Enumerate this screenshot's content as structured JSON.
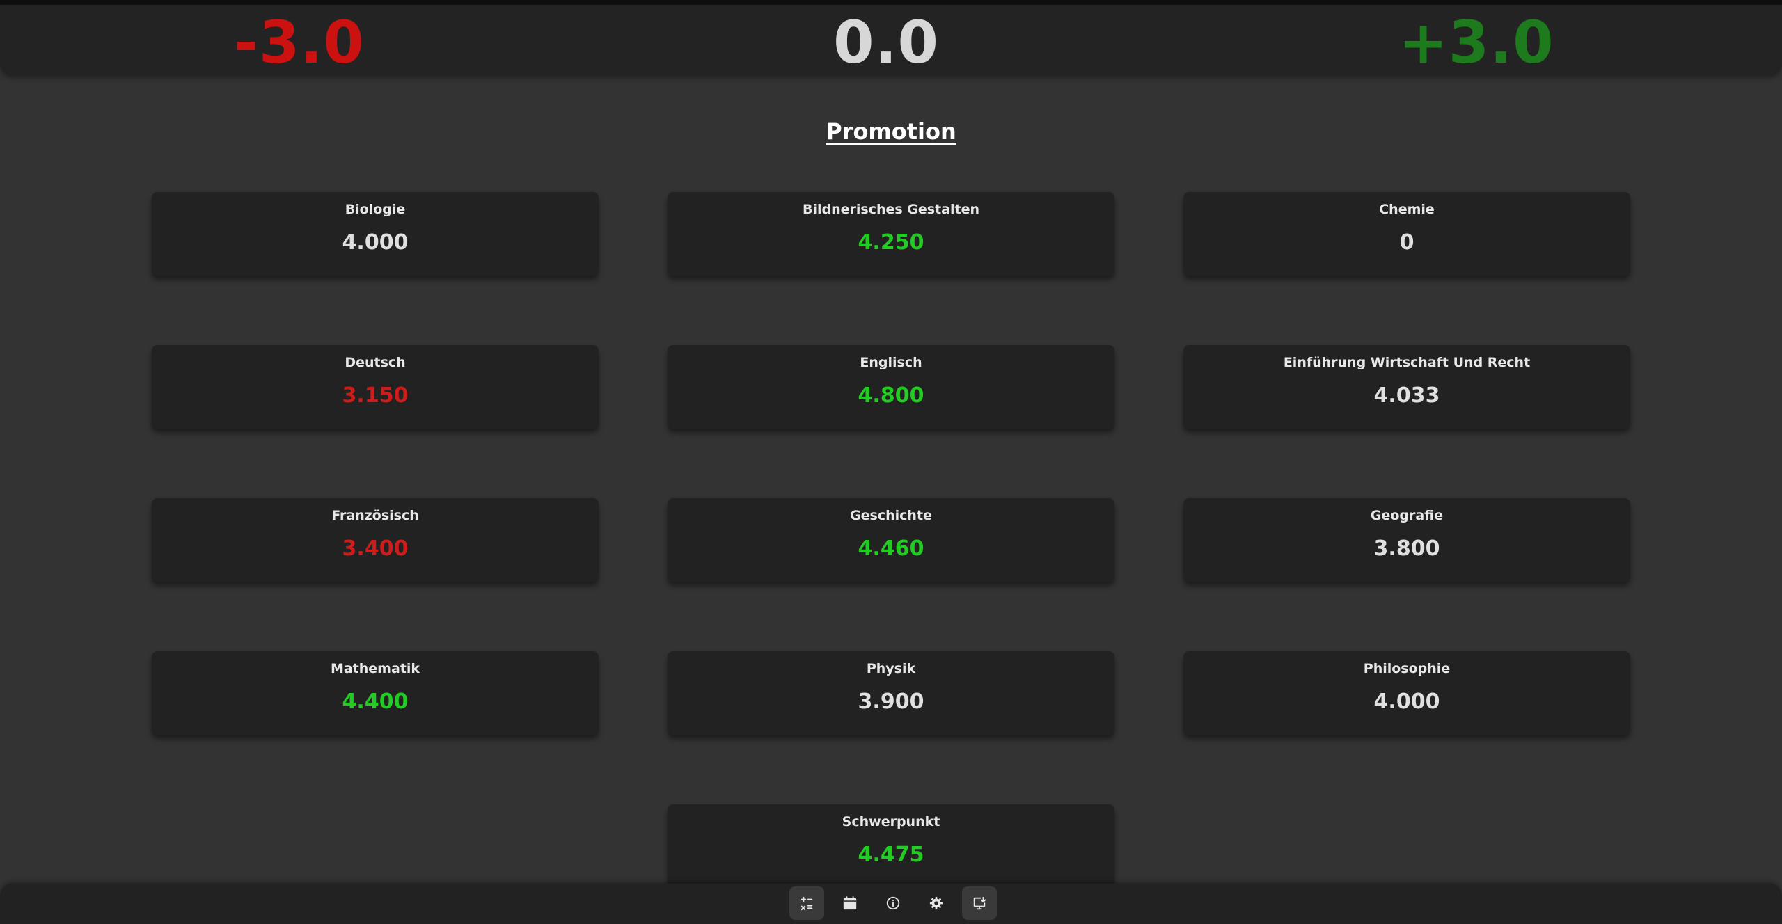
{
  "scores": {
    "negative": "-3.0",
    "zero": "0.0",
    "positive": "+3.0"
  },
  "page_title": "Promotion",
  "subjects": [
    {
      "name": "Biologie",
      "grade": "4.000",
      "status": "neutral"
    },
    {
      "name": "Bildnerisches Gestalten",
      "grade": "4.250",
      "status": "good"
    },
    {
      "name": "Chemie",
      "grade": "0",
      "status": "neutral"
    },
    {
      "name": "Deutsch",
      "grade": "3.150",
      "status": "bad"
    },
    {
      "name": "Englisch",
      "grade": "4.800",
      "status": "good"
    },
    {
      "name": "Einführung Wirtschaft Und Recht",
      "grade": "4.033",
      "status": "neutral"
    },
    {
      "name": "Französisch",
      "grade": "3.400",
      "status": "bad"
    },
    {
      "name": "Geschichte",
      "grade": "4.460",
      "status": "good"
    },
    {
      "name": "Geografie",
      "grade": "3.800",
      "status": "neutral"
    },
    {
      "name": "Mathematik",
      "grade": "4.400",
      "status": "good"
    },
    {
      "name": "Physik",
      "grade": "3.900",
      "status": "neutral"
    },
    {
      "name": "Philosophie",
      "grade": "4.000",
      "status": "neutral"
    },
    {
      "name": "Schwerpunkt",
      "grade": "4.475",
      "status": "good"
    }
  ],
  "colors": {
    "good": "#22cc22",
    "bad": "#cc1c1c",
    "neutral": "#e0e0e0"
  },
  "nav": [
    {
      "icon": "calculator-icon",
      "active": true
    },
    {
      "icon": "calendar-icon",
      "active": false
    },
    {
      "icon": "info-icon",
      "active": false
    },
    {
      "icon": "gear-icon",
      "active": false
    },
    {
      "icon": "export-icon",
      "active": true
    }
  ]
}
